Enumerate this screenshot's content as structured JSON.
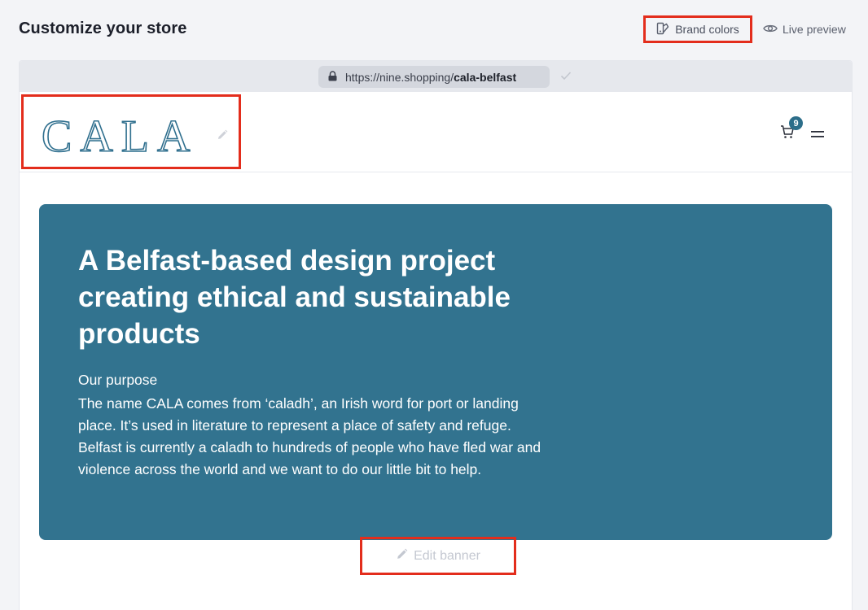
{
  "header": {
    "title": "Customize your store",
    "brand_colors_label": "Brand colors",
    "live_preview_label": "Live preview"
  },
  "browser": {
    "url_domain": "https://nine.shopping/",
    "url_path": "cala-belfast"
  },
  "store": {
    "logo_text": "CALA",
    "cart_count": "9"
  },
  "banner": {
    "title": "A Belfast-based design project creating ethical and sustainable products",
    "subtitle": "Our purpose",
    "body": "The name CALA comes from ‘caladh’, an Irish word for port or landing place. It’s used in literature to represent a place of safety and refuge. Belfast is currently a caladh to hundreds of people who have fled war and violence across the world and we want to do our little bit to help.",
    "edit_label": "Edit banner"
  },
  "colors": {
    "accent": "#32738f",
    "highlight": "#e32d1c"
  },
  "icons": {
    "brand_colors": "palette-icon",
    "live_preview": "eye-icon",
    "lock": "lock-icon",
    "check": "check-icon",
    "edit": "pencil-icon",
    "cart": "cart-icon",
    "menu": "menu-icon"
  }
}
